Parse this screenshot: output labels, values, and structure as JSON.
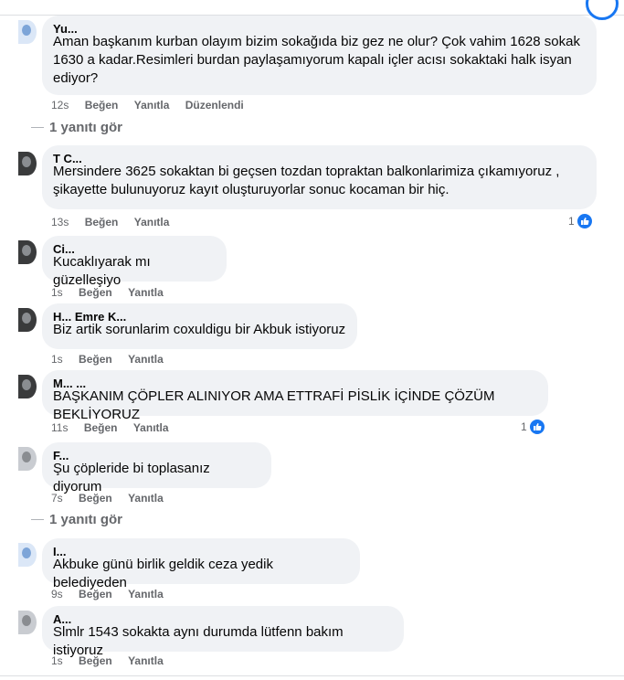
{
  "comments": [
    {
      "author": "Yu...",
      "text": "Aman başkanım kurban olayım bizim sokağıda biz gez ne olur? Çok vahim 1628 sokak 1630 a kadar.Resimleri burdan paylaşamıyorum kapalı içler acısı sokaktaki halk isyan ediyor?",
      "time": "12s",
      "like_label": "Beğen",
      "reply_label": "Yanıtla",
      "edited_label": "Düzenlendi"
    },
    {
      "author": "T Ç...",
      "text": "Mersindere 3625 sokaktan bi geçsen tozdan topraktan balkonlarimiza çıkamıyoruz , şikayette bulunuyoruz kayıt oluşturuyorlar sonuc kocaman bir hiç.",
      "time": "13s",
      "like_label": "Beğen",
      "reply_label": "Yanıtla",
      "reaction_count": "1"
    },
    {
      "author": "Ci...",
      "text": "Kucaklıyarak mı güzelleşiyo",
      "time": "1s",
      "like_label": "Beğen",
      "reply_label": "Yanıtla"
    },
    {
      "author": "H... Emre K...",
      "text": "Biz artik sorunlarim coxuldigu bir Akbuk istiyoruz",
      "time": "1s",
      "like_label": "Beğen",
      "reply_label": "Yanıtla"
    },
    {
      "author": "M... ...",
      "text": "BAŞKANIM ÇÖPLER ALINIYOR AMA ETTRAFİ PİSLİK İÇİNDE ÇÖZÜM BEKLİYORUZ",
      "time": "11s",
      "like_label": "Beğen",
      "reply_label": "Yanıtla",
      "reaction_count": "1"
    },
    {
      "author": "F...",
      "text": "Şu çöpleride bi toplasanız diyorum",
      "time": "7s",
      "like_label": "Beğen",
      "reply_label": "Yanıtla"
    },
    {
      "author": "I...",
      "text": "Akbuke günü birlik geldik ceza yedik belediyeden",
      "time": "9s",
      "like_label": "Beğen",
      "reply_label": "Yanıtla"
    },
    {
      "author": "A...",
      "text": "Slmlr 1543 sokakta aynı durumda lütfenn bakım istiyoruz",
      "time": "1s",
      "like_label": "Beğen",
      "reply_label": "Yanıtla"
    }
  ],
  "replies_link_1": "1 yanıtı gör",
  "replies_link_2": "1 yanıtı gör",
  "icons": {
    "like": "thumbs-up-icon",
    "avatar": "profile-avatar"
  },
  "colors": {
    "bubble": "#f0f2f5",
    "accent": "#1877f2",
    "meta": "#65676b"
  }
}
